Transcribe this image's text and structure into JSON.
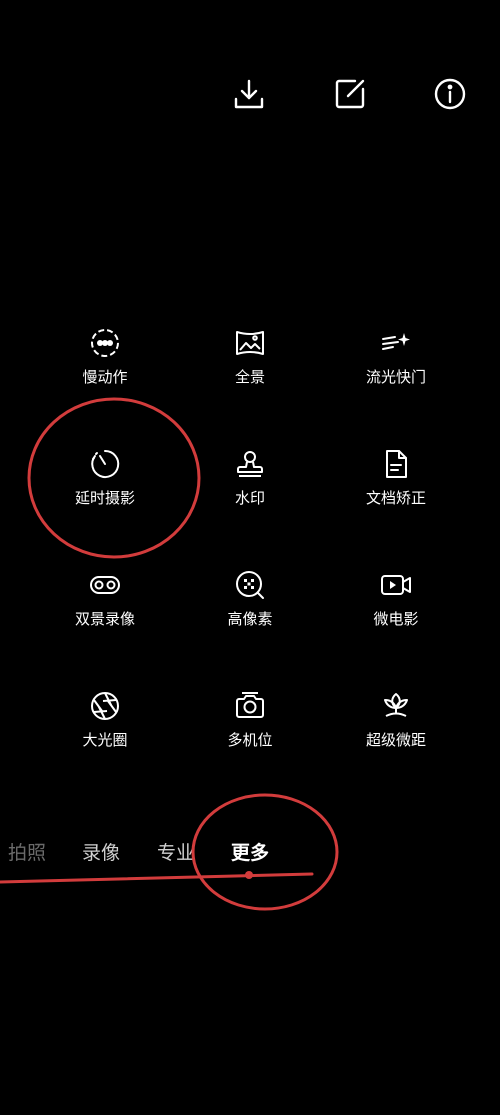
{
  "colors": {
    "background": "#000000",
    "text": "#ffffff",
    "annotation": "#d23c3c"
  },
  "toolbar": {
    "download_icon": "download-icon",
    "edit_icon": "edit-icon",
    "info_icon": "info-icon"
  },
  "modes": [
    {
      "label": "慢动作",
      "icon": "slow-motion-icon"
    },
    {
      "label": "全景",
      "icon": "panorama-icon"
    },
    {
      "label": "流光快门",
      "icon": "light-trail-icon"
    },
    {
      "label": "延时摄影",
      "icon": "timelapse-icon"
    },
    {
      "label": "水印",
      "icon": "watermark-stamp-icon"
    },
    {
      "label": "文档矫正",
      "icon": "document-icon"
    },
    {
      "label": "双景录像",
      "icon": "dual-view-icon"
    },
    {
      "label": "高像素",
      "icon": "high-resolution-icon"
    },
    {
      "label": "微电影",
      "icon": "video-icon"
    },
    {
      "label": "大光圈",
      "icon": "aperture-icon"
    },
    {
      "label": "多机位",
      "icon": "camera-icon"
    },
    {
      "label": "超级微距",
      "icon": "macro-flower-icon"
    }
  ],
  "tabs": [
    {
      "label": "拍照"
    },
    {
      "label": "录像"
    },
    {
      "label": "专业"
    },
    {
      "label": "更多",
      "active": true
    }
  ]
}
